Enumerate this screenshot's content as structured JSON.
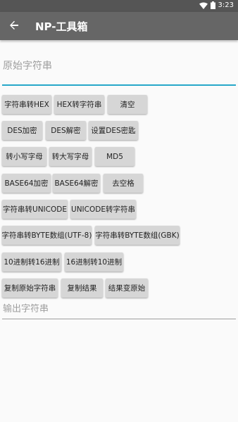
{
  "status_bar": {
    "time": "3:23"
  },
  "app_bar": {
    "title": "NP-工具箱"
  },
  "input": {
    "placeholder": "原始字符串",
    "value": ""
  },
  "buttons": {
    "str_to_hex": "字符串转HEX",
    "hex_to_str": "HEX转字符串",
    "clear": "清空",
    "des_encrypt": "DES加密",
    "des_decrypt": "DES解密",
    "set_des_key": "设置DES密匙",
    "to_lower": "转小写字母",
    "to_upper": "转大写字母",
    "md5": "MD5",
    "base64_encode": "BASE64加密",
    "base64_decode": "BASE64解密",
    "trim_spaces": "去空格",
    "str_to_unicode": "字符串转UNICODE",
    "unicode_to_str": "UNICODE转字符串",
    "str_to_utf8_bytes": "字符串转BYTE数组(UTF-8)",
    "str_to_gbk_bytes": "字符串转BYTE数组(GBK)",
    "dec_to_hex": "10进制转16进制",
    "hex_to_dec": "16进制转10进制",
    "copy_original": "复制原始字符串",
    "copy_result": "复制结果",
    "result_to_original": "结果变原始"
  },
  "output": {
    "placeholder": "输出字符串"
  }
}
